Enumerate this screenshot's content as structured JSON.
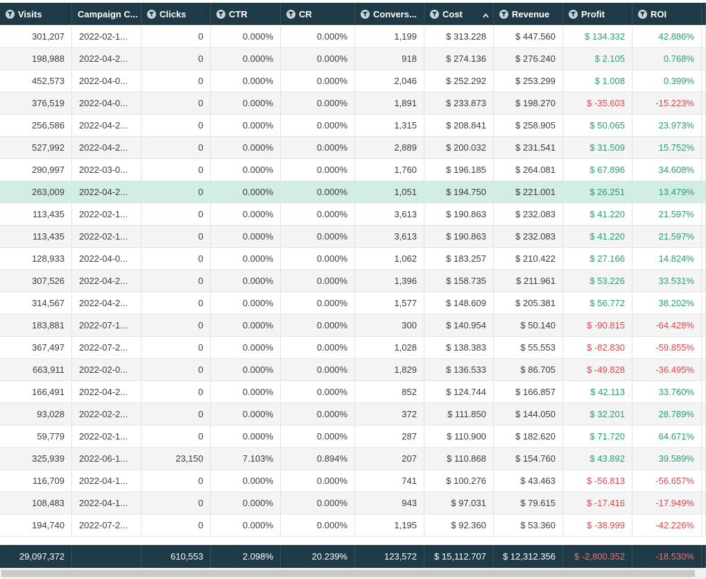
{
  "columns": [
    {
      "label": "Visits",
      "filter": true
    },
    {
      "label": "Campaign C...",
      "filter": false
    },
    {
      "label": "Clicks",
      "filter": true
    },
    {
      "label": "CTR",
      "filter": true
    },
    {
      "label": "CR",
      "filter": true
    },
    {
      "label": "Convers...",
      "filter": true
    },
    {
      "label": "Cost",
      "filter": true,
      "sorted": "asc-indicator-desc"
    },
    {
      "label": "Revenue",
      "filter": true
    },
    {
      "label": "Profit",
      "filter": true
    },
    {
      "label": "ROI",
      "filter": true
    }
  ],
  "rows": [
    {
      "visits": "301,207",
      "campaign": "2022-02-1...",
      "clicks": "0",
      "ctr": "0.000%",
      "cr": "0.000%",
      "conv": "1,199",
      "cost": "$ 313.228",
      "revenue": "$ 447.560",
      "profit": "$ 134.332",
      "roi": "42.886%",
      "sign": "pos"
    },
    {
      "visits": "198,988",
      "campaign": "2022-04-2...",
      "clicks": "0",
      "ctr": "0.000%",
      "cr": "0.000%",
      "conv": "918",
      "cost": "$ 274.136",
      "revenue": "$ 276.240",
      "profit": "$ 2.105",
      "roi": "0.768%",
      "sign": "pos"
    },
    {
      "visits": "452,573",
      "campaign": "2022-04-0...",
      "clicks": "0",
      "ctr": "0.000%",
      "cr": "0.000%",
      "conv": "2,046",
      "cost": "$ 252.292",
      "revenue": "$ 253.299",
      "profit": "$ 1.008",
      "roi": "0.399%",
      "sign": "pos"
    },
    {
      "visits": "376,519",
      "campaign": "2022-04-0...",
      "clicks": "0",
      "ctr": "0.000%",
      "cr": "0.000%",
      "conv": "1,891",
      "cost": "$ 233.873",
      "revenue": "$ 198.270",
      "profit": "$ -35.603",
      "roi": "-15.223%",
      "sign": "neg"
    },
    {
      "visits": "256,586",
      "campaign": "2022-04-2...",
      "clicks": "0",
      "ctr": "0.000%",
      "cr": "0.000%",
      "conv": "1,315",
      "cost": "$ 208.841",
      "revenue": "$ 258.905",
      "profit": "$ 50.065",
      "roi": "23.973%",
      "sign": "pos"
    },
    {
      "visits": "527,992",
      "campaign": "2022-04-2...",
      "clicks": "0",
      "ctr": "0.000%",
      "cr": "0.000%",
      "conv": "2,889",
      "cost": "$ 200.032",
      "revenue": "$ 231.541",
      "profit": "$ 31.509",
      "roi": "15.752%",
      "sign": "pos"
    },
    {
      "visits": "290,997",
      "campaign": "2022-03-0...",
      "clicks": "0",
      "ctr": "0.000%",
      "cr": "0.000%",
      "conv": "1,760",
      "cost": "$ 196.185",
      "revenue": "$ 264.081",
      "profit": "$ 67.896",
      "roi": "34.608%",
      "sign": "pos"
    },
    {
      "visits": "263,009",
      "campaign": "2022-04-2...",
      "clicks": "0",
      "ctr": "0.000%",
      "cr": "0.000%",
      "conv": "1,051",
      "cost": "$ 194.750",
      "revenue": "$ 221.001",
      "profit": "$ 26.251",
      "roi": "13.479%",
      "sign": "pos",
      "selected": true
    },
    {
      "visits": "113,435",
      "campaign": "2022-02-1...",
      "clicks": "0",
      "ctr": "0.000%",
      "cr": "0.000%",
      "conv": "3,613",
      "cost": "$ 190.863",
      "revenue": "$ 232.083",
      "profit": "$ 41.220",
      "roi": "21.597%",
      "sign": "pos"
    },
    {
      "visits": "113,435",
      "campaign": "2022-02-1...",
      "clicks": "0",
      "ctr": "0.000%",
      "cr": "0.000%",
      "conv": "3,613",
      "cost": "$ 190.863",
      "revenue": "$ 232.083",
      "profit": "$ 41.220",
      "roi": "21.597%",
      "sign": "pos"
    },
    {
      "visits": "128,933",
      "campaign": "2022-04-0...",
      "clicks": "0",
      "ctr": "0.000%",
      "cr": "0.000%",
      "conv": "1,062",
      "cost": "$ 183.257",
      "revenue": "$ 210.422",
      "profit": "$ 27.166",
      "roi": "14.824%",
      "sign": "pos"
    },
    {
      "visits": "307,526",
      "campaign": "2022-04-2...",
      "clicks": "0",
      "ctr": "0.000%",
      "cr": "0.000%",
      "conv": "1,396",
      "cost": "$ 158.735",
      "revenue": "$ 211.961",
      "profit": "$ 53.226",
      "roi": "33.531%",
      "sign": "pos"
    },
    {
      "visits": "314,567",
      "campaign": "2022-04-2...",
      "clicks": "0",
      "ctr": "0.000%",
      "cr": "0.000%",
      "conv": "1,577",
      "cost": "$ 148.609",
      "revenue": "$ 205.381",
      "profit": "$ 56.772",
      "roi": "38.202%",
      "sign": "pos"
    },
    {
      "visits": "183,881",
      "campaign": "2022-07-1...",
      "clicks": "0",
      "ctr": "0.000%",
      "cr": "0.000%",
      "conv": "300",
      "cost": "$ 140.954",
      "revenue": "$ 50.140",
      "profit": "$ -90.815",
      "roi": "-64.428%",
      "sign": "neg"
    },
    {
      "visits": "367,497",
      "campaign": "2022-07-2...",
      "clicks": "0",
      "ctr": "0.000%",
      "cr": "0.000%",
      "conv": "1,028",
      "cost": "$ 138.383",
      "revenue": "$ 55.553",
      "profit": "$ -82.830",
      "roi": "-59.855%",
      "sign": "neg"
    },
    {
      "visits": "663,911",
      "campaign": "2022-02-0...",
      "clicks": "0",
      "ctr": "0.000%",
      "cr": "0.000%",
      "conv": "1,829",
      "cost": "$ 136.533",
      "revenue": "$ 86.705",
      "profit": "$ -49.828",
      "roi": "-36.495%",
      "sign": "neg"
    },
    {
      "visits": "166,491",
      "campaign": "2022-04-2...",
      "clicks": "0",
      "ctr": "0.000%",
      "cr": "0.000%",
      "conv": "852",
      "cost": "$ 124.744",
      "revenue": "$ 166.857",
      "profit": "$ 42.113",
      "roi": "33.760%",
      "sign": "pos"
    },
    {
      "visits": "93,028",
      "campaign": "2022-02-2...",
      "clicks": "0",
      "ctr": "0.000%",
      "cr": "0.000%",
      "conv": "372",
      "cost": "$ 111.850",
      "revenue": "$ 144.050",
      "profit": "$ 32.201",
      "roi": "28.789%",
      "sign": "pos"
    },
    {
      "visits": "59,779",
      "campaign": "2022-02-1...",
      "clicks": "0",
      "ctr": "0.000%",
      "cr": "0.000%",
      "conv": "287",
      "cost": "$ 110.900",
      "revenue": "$ 182.620",
      "profit": "$ 71.720",
      "roi": "64.671%",
      "sign": "pos"
    },
    {
      "visits": "325,939",
      "campaign": "2022-06-1...",
      "clicks": "23,150",
      "ctr": "7.103%",
      "cr": "0.894%",
      "conv": "207",
      "cost": "$ 110.868",
      "revenue": "$ 154.760",
      "profit": "$ 43.892",
      "roi": "39.589%",
      "sign": "pos"
    },
    {
      "visits": "116,709",
      "campaign": "2022-04-1...",
      "clicks": "0",
      "ctr": "0.000%",
      "cr": "0.000%",
      "conv": "741",
      "cost": "$ 100.276",
      "revenue": "$ 43.463",
      "profit": "$ -56.813",
      "roi": "-56.657%",
      "sign": "neg"
    },
    {
      "visits": "108,483",
      "campaign": "2022-04-1...",
      "clicks": "0",
      "ctr": "0.000%",
      "cr": "0.000%",
      "conv": "943",
      "cost": "$ 97.031",
      "revenue": "$ 79.615",
      "profit": "$ -17.416",
      "roi": "-17.949%",
      "sign": "neg"
    },
    {
      "visits": "194,740",
      "campaign": "2022-07-2...",
      "clicks": "0",
      "ctr": "0.000%",
      "cr": "0.000%",
      "conv": "1,195",
      "cost": "$ 92.360",
      "revenue": "$ 53.360",
      "profit": "$ -38.999",
      "roi": "-42.226%",
      "sign": "neg"
    }
  ],
  "totals": {
    "visits": "29,097,372",
    "campaign": "",
    "clicks": "610,553",
    "ctr": "2.098%",
    "cr": "20.239%",
    "conv": "123,572",
    "cost": "$ 15,112.707",
    "revenue": "$ 12,312.356",
    "profit": "$ -2,800.352",
    "roi": "-18.530%",
    "sign": "neg"
  },
  "colors": {
    "header_bg": "#1f3a47",
    "positive": "#2e9a72",
    "negative": "#d9484b",
    "selected_row": "#d2ece6"
  },
  "icons": {
    "filter": "filter-icon",
    "sort": "sort-caret-icon"
  }
}
